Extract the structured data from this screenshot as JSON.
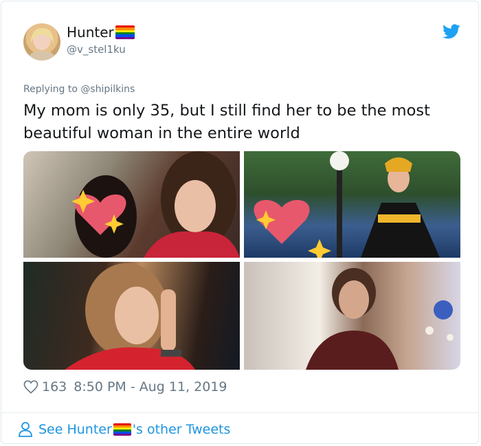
{
  "user": {
    "display_name": "Hunter",
    "handle": "@v_stel1ku",
    "avatar_icon": "avatar"
  },
  "icons": {
    "verified_flag": "rainbow-flag-icon",
    "brand": "twitter-bird-icon",
    "like": "heart-outline-icon",
    "profile": "person-icon"
  },
  "colors": {
    "brand_blue": "#1da1f2",
    "link_blue": "#1b95e0",
    "muted_gray": "#657786",
    "rainbow": [
      "#e40303",
      "#ff8c00",
      "#ffed00",
      "#008026",
      "#004dff",
      "#750787"
    ]
  },
  "tweet": {
    "replying_to": "Replying to @shipilkins",
    "text": "My mom is only 35, but I still find her to be the most beautiful woman in the entire world",
    "media_count": 4
  },
  "meta": {
    "likes": "163",
    "timestamp": "8:50 PM - Aug 11, 2019"
  },
  "footer": {
    "prefix": "See Hunter",
    "suffix": "'s other Tweets"
  }
}
